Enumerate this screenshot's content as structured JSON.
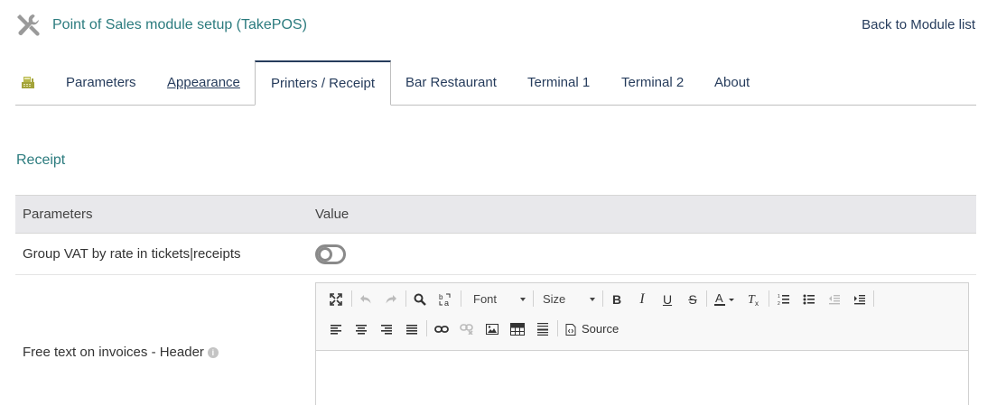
{
  "header": {
    "title": "Point of Sales module setup (TakePOS)",
    "back_link": "Back to Module list"
  },
  "tabs": [
    {
      "label": "Parameters"
    },
    {
      "label": "Appearance"
    },
    {
      "label": "Printers / Receipt"
    },
    {
      "label": "Bar Restaurant"
    },
    {
      "label": "Terminal 1"
    },
    {
      "label": "Terminal 2"
    },
    {
      "label": "About"
    }
  ],
  "active_tab": "Printers / Receipt",
  "section": {
    "title": "Receipt"
  },
  "table": {
    "headers": [
      "Parameters",
      "Value"
    ],
    "rows": [
      {
        "label": "Group VAT by rate in tickets|receipts",
        "value": "off"
      },
      {
        "label": "Free text on invoices - Header"
      }
    ]
  },
  "editor": {
    "font_label": "Font",
    "size_label": "Size",
    "source_label": "Source"
  },
  "colors": {
    "accent": "#2b7b7e",
    "link": "#263c5c"
  }
}
